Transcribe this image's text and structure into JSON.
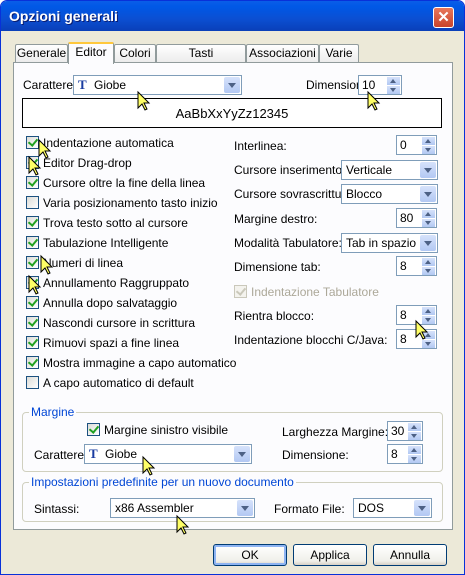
{
  "window": {
    "title": "Opzioni generali",
    "close_symbol": "✕"
  },
  "tabs": [
    "Generale",
    "Editor",
    "Colori",
    "Tasti esecuzione",
    "Associazioni",
    "Varie"
  ],
  "editor": {
    "font_label": "Carattere:",
    "font_value": "Giobe",
    "size_label": "Dimensione:",
    "size_value": "10",
    "preview_text": "AaBbXxYyZz12345",
    "checkboxes": [
      {
        "label": "Indentazione automatica",
        "checked": true
      },
      {
        "label": "Editor Drag-drop",
        "checked": true
      },
      {
        "label": "Cursore oltre la fine della linea",
        "checked": true
      },
      {
        "label": "Varia posizionamento tasto inizio",
        "checked": false
      },
      {
        "label": "Trova testo sotto al cursore",
        "checked": true
      },
      {
        "label": "Tabulazione Intelligente",
        "checked": true
      },
      {
        "label": "Numeri di linea",
        "checked": true
      },
      {
        "label": "Annullamento Raggruppato",
        "checked": true
      },
      {
        "label": "Annulla dopo salvataggio",
        "checked": true
      },
      {
        "label": "Nascondi cursore in scrittura",
        "checked": true
      },
      {
        "label": "Rimuovi spazi a fine linea",
        "checked": true
      },
      {
        "label": "Mostra immagine a capo automatico",
        "checked": true
      },
      {
        "label": "A capo automatico di default",
        "checked": false
      }
    ],
    "line_spacing": {
      "label": "Interlinea:",
      "value": "0"
    },
    "insert_cursor": {
      "label": "Cursore inserimento:",
      "value": "Verticale"
    },
    "overwrite_cursor": {
      "label": "Cursore sovrascrittura:",
      "value": "Blocco"
    },
    "right_margin": {
      "label": "Margine destro:",
      "value": "80"
    },
    "tab_mode": {
      "label": "Modalità Tabulatore:",
      "value": "Tab in spazio"
    },
    "tab_size": {
      "label": "Dimensione tab:",
      "value": "8"
    },
    "tab_indent": {
      "label": "Indentazione Tabulatore",
      "checked": true,
      "disabled": true
    },
    "block_indent": {
      "label": "Rientra blocco:",
      "value": "8"
    },
    "cjava_indent": {
      "label": "Indentazione blocchi C/Java:",
      "value": "8"
    }
  },
  "margin_group": {
    "title": "Margine",
    "left_margin_visible": {
      "label": "Margine sinistro visibile",
      "checked": true
    },
    "margin_width": {
      "label": "Larghezza Margine:",
      "value": "30"
    },
    "font_label": "Carattere:",
    "font_value": "Giobe",
    "size_label": "Dimensione:",
    "size_value": "8"
  },
  "defaults_group": {
    "title": "Impostazioni predefinite per un nuovo documento",
    "syntax_label": "Sintassi:",
    "syntax_value": "x86 Assembler",
    "file_format_label": "Formato File:",
    "file_format_value": "DOS"
  },
  "buttons": {
    "ok": "OK",
    "apply": "Applica",
    "cancel": "Annulla"
  },
  "colors": {
    "titlebar": "#0058e6",
    "group_title": "#0046d5",
    "check_mark": "#21a121",
    "cursor_fill": "#ffff66"
  }
}
